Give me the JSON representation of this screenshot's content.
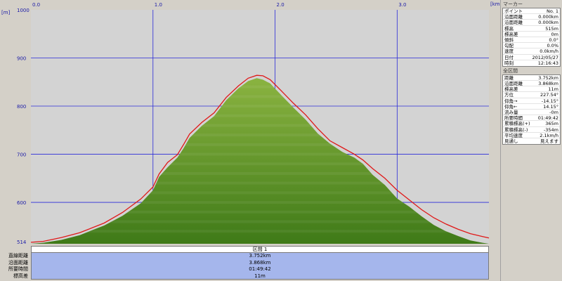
{
  "chart_data": {
    "type": "area",
    "xlabel": "[km]",
    "ylabel": "[m]",
    "xlim": [
      0,
      3.752
    ],
    "ylim": [
      514,
      1000
    ],
    "x_ticks": [
      "0.0",
      "1.0",
      "2.0",
      "3.0"
    ],
    "y_ticks": [
      "1000",
      "900",
      "800",
      "700",
      "600",
      "514"
    ],
    "series": [
      {
        "kind": "terrain-fill",
        "x": [
          0,
          0.1,
          0.25,
          0.4,
          0.5,
          0.6,
          0.75,
          0.9,
          1.0,
          1.05,
          1.12,
          1.2,
          1.25,
          1.3,
          1.4,
          1.5,
          1.6,
          1.7,
          1.78,
          1.85,
          1.9,
          1.96,
          2.05,
          2.15,
          2.25,
          2.35,
          2.45,
          2.55,
          2.65,
          2.72,
          2.8,
          2.9,
          3.0,
          3.1,
          3.2,
          3.3,
          3.4,
          3.5,
          3.6,
          3.7,
          3.752
        ],
        "y": [
          514,
          516,
          522,
          532,
          542,
          552,
          572,
          598,
          625,
          653,
          673,
          693,
          712,
          734,
          759,
          779,
          812,
          837,
          852,
          858,
          855,
          847,
          823,
          797,
          772,
          743,
          722,
          705,
          693,
          680,
          657,
          636,
          608,
          591,
          571,
          553,
          540,
          530,
          521,
          516,
          514
        ]
      },
      {
        "kind": "profile-line",
        "color": "#e01818",
        "x": [
          0,
          0.1,
          0.25,
          0.4,
          0.5,
          0.6,
          0.75,
          0.9,
          1.0,
          1.05,
          1.12,
          1.2,
          1.25,
          1.3,
          1.4,
          1.5,
          1.6,
          1.7,
          1.78,
          1.85,
          1.9,
          1.96,
          2.05,
          2.15,
          2.25,
          2.35,
          2.45,
          2.55,
          2.65,
          2.72,
          2.8,
          2.9,
          3.0,
          3.1,
          3.2,
          3.3,
          3.4,
          3.5,
          3.6,
          3.7,
          3.752
        ],
        "y": [
          517,
          519,
          527,
          537,
          547,
          557,
          579,
          607,
          632,
          659,
          683,
          699,
          720,
          742,
          766,
          786,
          818,
          842,
          858,
          864,
          863,
          855,
          832,
          806,
          782,
          753,
          728,
          714,
          700,
          688,
          670,
          650,
          625,
          605,
          585,
          568,
          555,
          544,
          535,
          529,
          526
        ]
      }
    ],
    "grid": true
  },
  "colors": {
    "plot_bg": "#d3d3d3",
    "grid": "#2a2ad8",
    "fill_top": "#8ab340",
    "fill_bottom": "#3f7a18",
    "line": "#e01818",
    "summary_bg": "#a5b6ec"
  },
  "summary": {
    "section_label": "区間 1",
    "labels": [
      "直線距離",
      "沿面距離",
      "所要時間",
      "標高差"
    ],
    "values": [
      "3.752km",
      "3.868km",
      "01:49:42",
      "11m"
    ]
  },
  "marker_panel": {
    "title": "マーカー",
    "rows": [
      {
        "label": "ポイント",
        "value": "No. 1"
      },
      {
        "label": "沿面距離",
        "value": "0.000km"
      },
      {
        "label": "沿面距離",
        "value": "0.000km"
      },
      {
        "label": "標高",
        "value": "515m"
      },
      {
        "label": "標高差",
        "value": "0m"
      },
      {
        "label": "傾斜",
        "value": "0.0°"
      },
      {
        "label": "勾配",
        "value": "0.0%"
      },
      {
        "label": "速度",
        "value": "0.0km/h"
      },
      {
        "label": "日付",
        "value": "2012/05/27"
      },
      {
        "label": "時刻",
        "value": "12:16:43"
      }
    ]
  },
  "section_panel": {
    "title": "全区間",
    "rows": [
      {
        "label": "距離",
        "value": "3.752km"
      },
      {
        "label": "沿面距離",
        "value": "3.868km"
      },
      {
        "label": "標高差",
        "value": "11m"
      },
      {
        "label": "方位",
        "value": "227.54°"
      },
      {
        "label": "仰角→",
        "value": "-14.15°"
      },
      {
        "label": "仰角←",
        "value": "14.15°"
      },
      {
        "label": "流み量",
        "value": "-0m"
      },
      {
        "label": "所要時間",
        "value": "01:49:42"
      },
      {
        "label": "累積標高(+)",
        "value": "365m"
      },
      {
        "label": "累積標高(-)",
        "value": "-354m"
      },
      {
        "label": "平均速度",
        "value": "2.1km/h"
      },
      {
        "label": "見通し",
        "value": "見えます"
      }
    ]
  }
}
